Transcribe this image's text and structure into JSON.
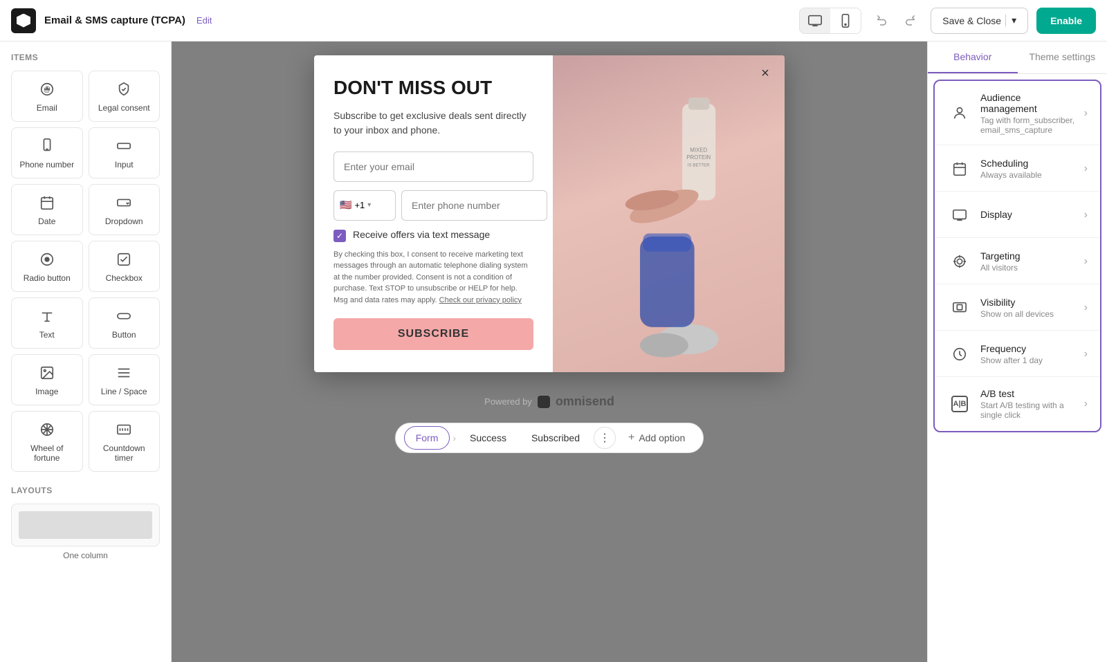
{
  "topbar": {
    "title": "Email & SMS capture (TCPA)",
    "edit_label": "Edit",
    "save_label": "Save & Close",
    "enable_label": "Enable",
    "device_desktop_title": "Desktop view",
    "device_mobile_title": "Mobile view"
  },
  "left_sidebar": {
    "items_title": "Items",
    "items": [
      {
        "id": "email",
        "label": "Email",
        "icon": "at"
      },
      {
        "id": "legal-consent",
        "label": "Legal consent",
        "icon": "shield"
      },
      {
        "id": "phone-number",
        "label": "Phone number",
        "icon": "phone"
      },
      {
        "id": "input",
        "label": "Input",
        "icon": "input"
      },
      {
        "id": "date",
        "label": "Date",
        "icon": "date"
      },
      {
        "id": "dropdown",
        "label": "Dropdown",
        "icon": "dropdown"
      },
      {
        "id": "radio-button",
        "label": "Radio button",
        "icon": "radio"
      },
      {
        "id": "checkbox",
        "label": "Checkbox",
        "icon": "checkbox"
      },
      {
        "id": "text",
        "label": "Text",
        "icon": "text"
      },
      {
        "id": "button",
        "label": "Button",
        "icon": "button"
      },
      {
        "id": "image",
        "label": "Image",
        "icon": "image"
      },
      {
        "id": "line-space",
        "label": "Line / Space",
        "icon": "line"
      },
      {
        "id": "wheel-fortune",
        "label": "Wheel of fortune",
        "icon": "wheel"
      },
      {
        "id": "countdown",
        "label": "Countdown timer",
        "icon": "countdown"
      }
    ],
    "layouts_title": "Layouts",
    "layout_one_column": "One column"
  },
  "popup": {
    "close_btn": "×",
    "headline": "DON'T MISS OUT",
    "subtext": "Subscribe to get exclusive deals sent directly to your inbox and phone.",
    "email_placeholder": "Enter your email",
    "country_code": "+1",
    "country_flag": "🇺🇸",
    "phone_placeholder": "Enter phone number",
    "checkbox_label": "Receive offers via text message",
    "legal_text": "By checking this box, I consent to receive marketing text messages through an automatic telephone dialing system at the number provided. Consent is not a condition of purchase. Text STOP to unsubscribe or HELP for help. Msg and data rates may apply.",
    "legal_link": "Check our privacy policy",
    "subscribe_btn": "SUBSCRIBE",
    "powered_by": "Powered by",
    "brand_name": "omnisend"
  },
  "bottom_tabs": {
    "form_label": "Form",
    "success_label": "Success",
    "subscribed_label": "Subscribed",
    "add_option_label": "Add option"
  },
  "right_panel": {
    "tab_behavior": "Behavior",
    "tab_theme": "Theme settings",
    "behavior_items": [
      {
        "id": "audience",
        "title": "Audience management",
        "subtitle": "Tag with form_subscriber, email_sms_capture",
        "icon": "person"
      },
      {
        "id": "scheduling",
        "title": "Scheduling",
        "subtitle": "Always available",
        "icon": "calendar"
      },
      {
        "id": "display",
        "title": "Display",
        "subtitle": "",
        "icon": "display"
      },
      {
        "id": "targeting",
        "title": "Targeting",
        "subtitle": "All visitors",
        "icon": "targeting"
      },
      {
        "id": "visibility",
        "title": "Visibility",
        "subtitle": "Show on all devices",
        "icon": "visibility"
      },
      {
        "id": "frequency",
        "title": "Frequency",
        "subtitle": "Show after 1 day",
        "icon": "frequency"
      },
      {
        "id": "ab-test",
        "title": "A/B test",
        "subtitle": "Start A/B testing with a single click",
        "icon": "ab"
      }
    ]
  },
  "colors": {
    "accent": "#7c5cbf",
    "enable_btn": "#00a98f",
    "subscribe_btn_bg": "#f4a8a8"
  }
}
